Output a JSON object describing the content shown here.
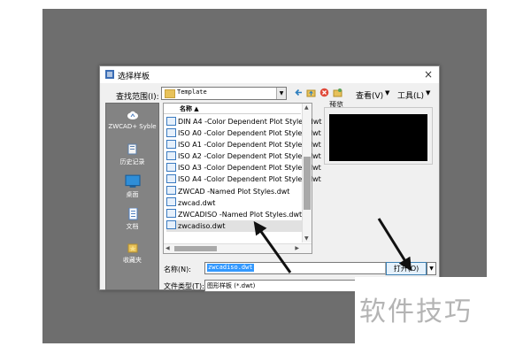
{
  "dialog": {
    "title": "选择样板",
    "close_label": "×"
  },
  "toolbar": {
    "lookin_label": "查找范围(I):",
    "lookin_value": "Template",
    "view_label": "查看(V)",
    "tools_label": "工具(L)"
  },
  "places": [
    {
      "label": "ZWCAD+ Syble",
      "icon": "cloud-icon"
    },
    {
      "label": "历史记录",
      "icon": "history-icon"
    },
    {
      "label": "桌面",
      "icon": "desktop-icon"
    },
    {
      "label": "文档",
      "icon": "documents-icon"
    },
    {
      "label": "收藏夹",
      "icon": "favorites-icon"
    }
  ],
  "filelist": {
    "column_header": "名称",
    "files": [
      "DIN A4 -Color Dependent Plot Styles.dwt",
      "ISO A0 -Color Dependent Plot Styles.dwt",
      "ISO A1 -Color Dependent Plot Styles.dwt",
      "ISO A2 -Color Dependent Plot Styles.dwt",
      "ISO A3 -Color Dependent Plot Styles.dwt",
      "ISO A4 -Color Dependent Plot Styles.dwt",
      "ZWCAD -Named Plot Styles.dwt",
      "zwcad.dwt",
      "ZWCADISO -Named Plot Styles.dwt",
      "zwcadiso.dwt"
    ],
    "selected_index": 9
  },
  "preview": {
    "label": "预览"
  },
  "form": {
    "name_label": "名称(N):",
    "name_value": "zwcadiso.dwt",
    "type_label": "文件类型(T):",
    "type_value": "图形样板 (*.dwt)",
    "open_label": "打开(O)"
  },
  "watermark": {
    "text": "软件技巧"
  },
  "colors": {
    "backdrop": "#6e6e6e",
    "dialog_bg": "#f0f0f0",
    "places_bg": "#838383",
    "selection": "#3399ff"
  }
}
